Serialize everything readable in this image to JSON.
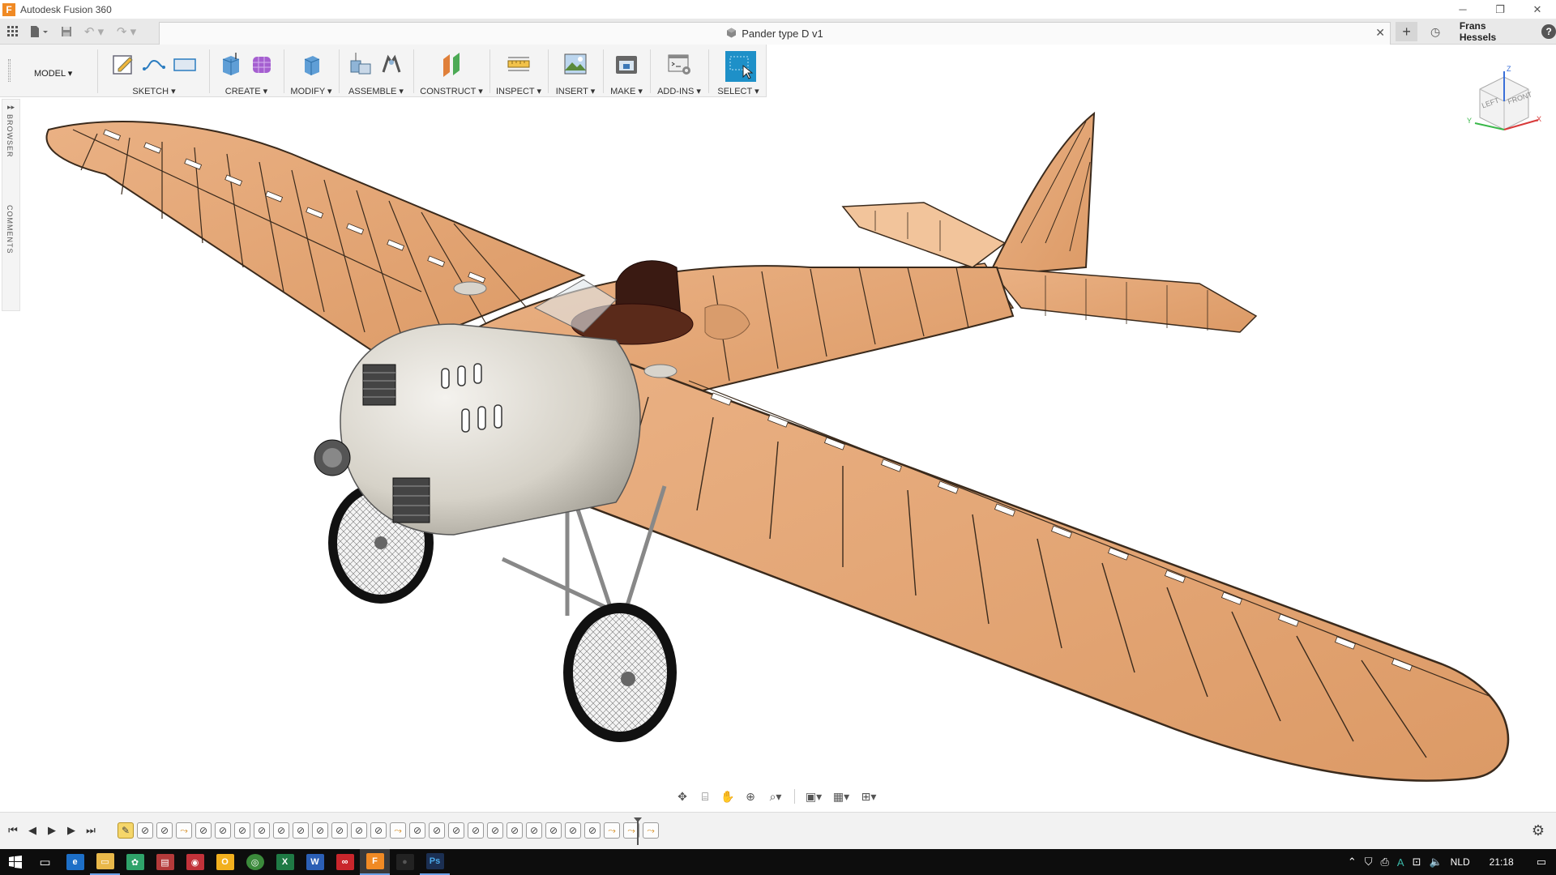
{
  "window": {
    "app_title": "Autodesk Fusion 360",
    "controls": [
      "─",
      "❐",
      "✕"
    ]
  },
  "quick_access": {
    "document_tab": "Pander type D v1",
    "new_tab_symbol": "+",
    "user_name": "Frans Hessels",
    "help_symbol": "?"
  },
  "ribbon": {
    "workspace": "MODEL",
    "groups": {
      "sketch": "SKETCH",
      "create": "CREATE",
      "modify": "MODIFY",
      "assemble": "ASSEMBLE",
      "construct": "CONSTRUCT",
      "inspect": "INSPECT",
      "insert": "INSERT",
      "make": "MAKE",
      "addins": "ADD-INS",
      "select": "SELECT"
    },
    "dropdown_arrow": "▾"
  },
  "side_panel": {
    "browser": "BROWSER",
    "comments": "COMMENTS"
  },
  "viewcube": {
    "left": "LEFT",
    "front": "FRONT",
    "axis_x": "X",
    "axis_y": "Y",
    "axis_z": "Z"
  },
  "timeline": {
    "features": [
      "sketch",
      "op",
      "op",
      "move",
      "op",
      "op",
      "op",
      "op",
      "op",
      "op",
      "op",
      "op",
      "op",
      "op",
      "move",
      "op",
      "op",
      "op",
      "op",
      "op",
      "op",
      "op",
      "op",
      "op",
      "op",
      "move",
      "move",
      "move"
    ]
  },
  "taskbar": {
    "language": "NLD",
    "clock": "21:18"
  },
  "colors": {
    "wing_skin": "#e6a877",
    "wing_frame": "#3a2a1c",
    "fuselage_metal": "#d9d6cf",
    "select_accent": "#1e90c8",
    "taskbar_bg": "#0d0d0d"
  },
  "icons": [
    "grid-icon",
    "file-icon",
    "save-icon",
    "undo-icon",
    "redo-icon",
    "cube-icon",
    "clock-icon",
    "help-icon",
    "gear-icon"
  ]
}
